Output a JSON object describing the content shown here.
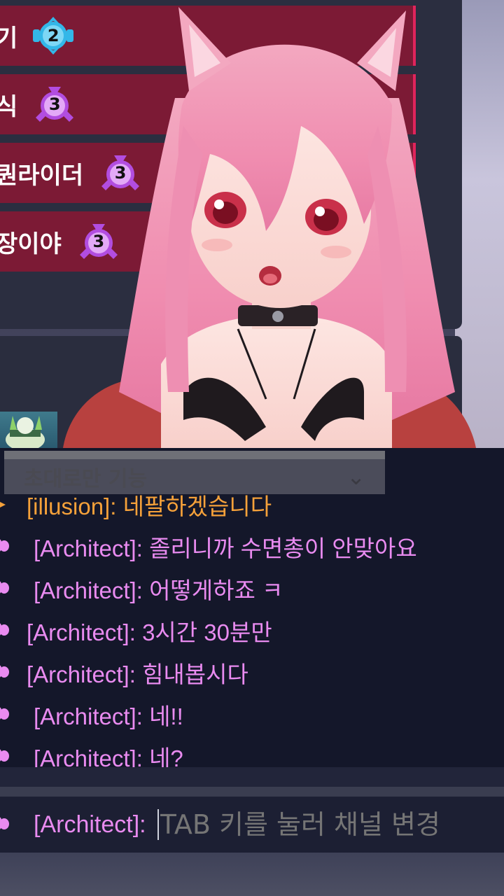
{
  "queue": [
    {
      "label": "기",
      "rank": "2",
      "color": "#33b7e8"
    },
    {
      "label": "식",
      "rank": "3",
      "color": "#b24de0"
    },
    {
      "label": "퀀라이더",
      "rank": "3",
      "color": "#b24de0"
    },
    {
      "label": "장이야",
      "rank": "3",
      "color": "#b24de0"
    }
  ],
  "chat": {
    "channel_label": "초대로만 기능",
    "messages": [
      {
        "speaker": "[illusion]",
        "text": "네팔하겠습니다",
        "color": "#f5a13a"
      },
      {
        "speaker": "[Architect]",
        "text": "졸리니까 수면총이 안맞아요",
        "color": "#e98bf0"
      },
      {
        "speaker": "[Architect]",
        "text": "어떻게하죠 ㅋ",
        "color": "#e98bf0"
      },
      {
        "speaker": "[Architect]",
        "text": "3시간 30분만",
        "color": "#e98bf0"
      },
      {
        "speaker": "[Architect]",
        "text": "힘내봅시다",
        "color": "#e98bf0"
      },
      {
        "speaker": "[Architect]",
        "text": "네!!",
        "color": "#e98bf0"
      },
      {
        "speaker": "[Architect]",
        "text": "네?",
        "color": "#e98bf0"
      }
    ],
    "input": {
      "speaker": "[Architect]:",
      "placeholder": "TAB 키를 눌러 채널 변경"
    }
  }
}
